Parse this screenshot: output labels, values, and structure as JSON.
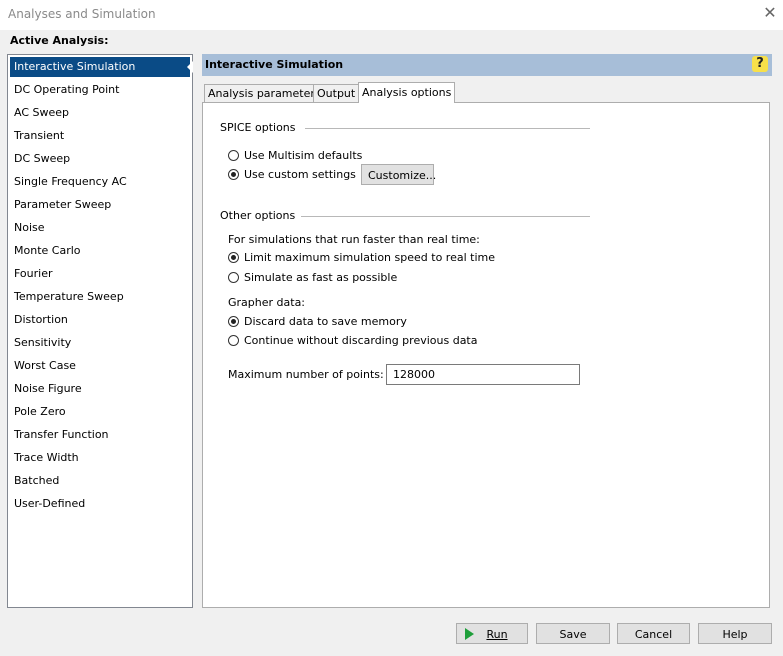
{
  "window": {
    "title": "Analyses and Simulation",
    "close_glyph": "✕"
  },
  "active_analysis_label": "Active Analysis:",
  "analyses": [
    "Interactive Simulation",
    "DC Operating Point",
    "AC Sweep",
    "Transient",
    "DC Sweep",
    "Single Frequency AC",
    "Parameter Sweep",
    "Noise",
    "Monte Carlo",
    "Fourier",
    "Temperature Sweep",
    "Distortion",
    "Sensitivity",
    "Worst Case",
    "Noise Figure",
    "Pole Zero",
    "Transfer Function",
    "Trace Width",
    "Batched",
    "User-Defined"
  ],
  "selected_index": 0,
  "header": {
    "title": "Interactive Simulation",
    "help": "?"
  },
  "tabs": [
    "Analysis parameters",
    "Output",
    "Analysis options"
  ],
  "active_tab": 2,
  "spice": {
    "title": "SPICE options",
    "opt_default": "Use Multisim defaults",
    "opt_custom": "Use custom settings",
    "customize": "Customize...",
    "selected": "custom"
  },
  "other": {
    "title": "Other options",
    "faster_label": "For simulations that run faster than real time:",
    "limit": "Limit maximum simulation speed to real time",
    "fast": "Simulate as fast as possible",
    "grapher_label": "Grapher data:",
    "discard": "Discard data to save memory",
    "continue": "Continue without discarding previous data",
    "max_points_label": "Maximum number of points:",
    "max_points_value": "128000"
  },
  "buttons": {
    "run": "Run",
    "save": "Save",
    "cancel": "Cancel",
    "help": "Help"
  },
  "colors": {
    "selection": "#0a4b86",
    "header": "#a7bed8",
    "run_icon": "#1e9e3a"
  }
}
